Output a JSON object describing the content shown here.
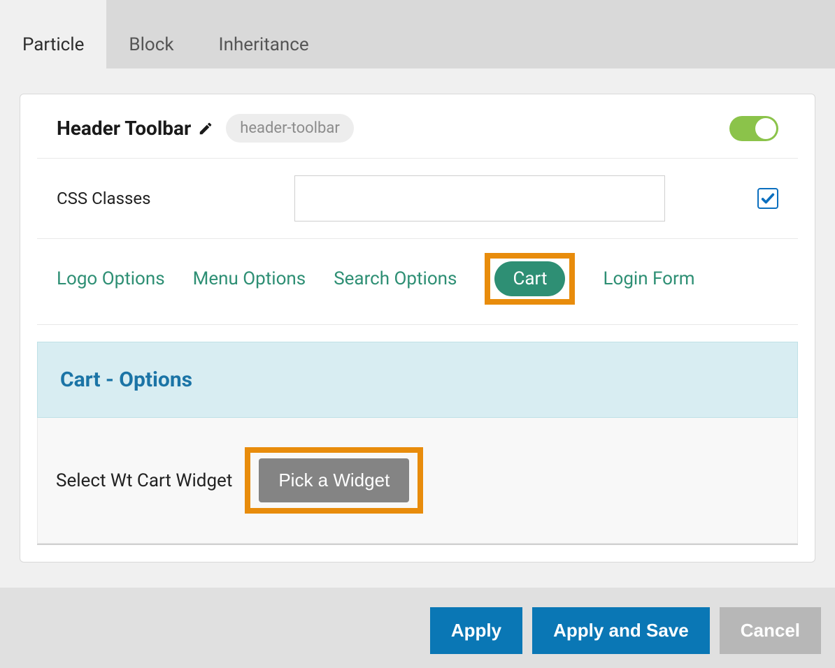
{
  "tabs": {
    "particle": "Particle",
    "block": "Block",
    "inheritance": "Inheritance"
  },
  "panel": {
    "title": "Header Toolbar",
    "slug": "header-toolbar"
  },
  "fields": {
    "css_classes_label": "CSS Classes",
    "css_classes_value": ""
  },
  "subtabs": {
    "logo": "Logo Options",
    "menu": "Menu Options",
    "search": "Search Options",
    "cart": "Cart",
    "login": "Login Form"
  },
  "section": {
    "title": "Cart - Options",
    "select_label": "Select Wt Cart Widget",
    "pick_button": "Pick a Widget"
  },
  "footer": {
    "apply": "Apply",
    "apply_save": "Apply and Save",
    "cancel": "Cancel"
  }
}
